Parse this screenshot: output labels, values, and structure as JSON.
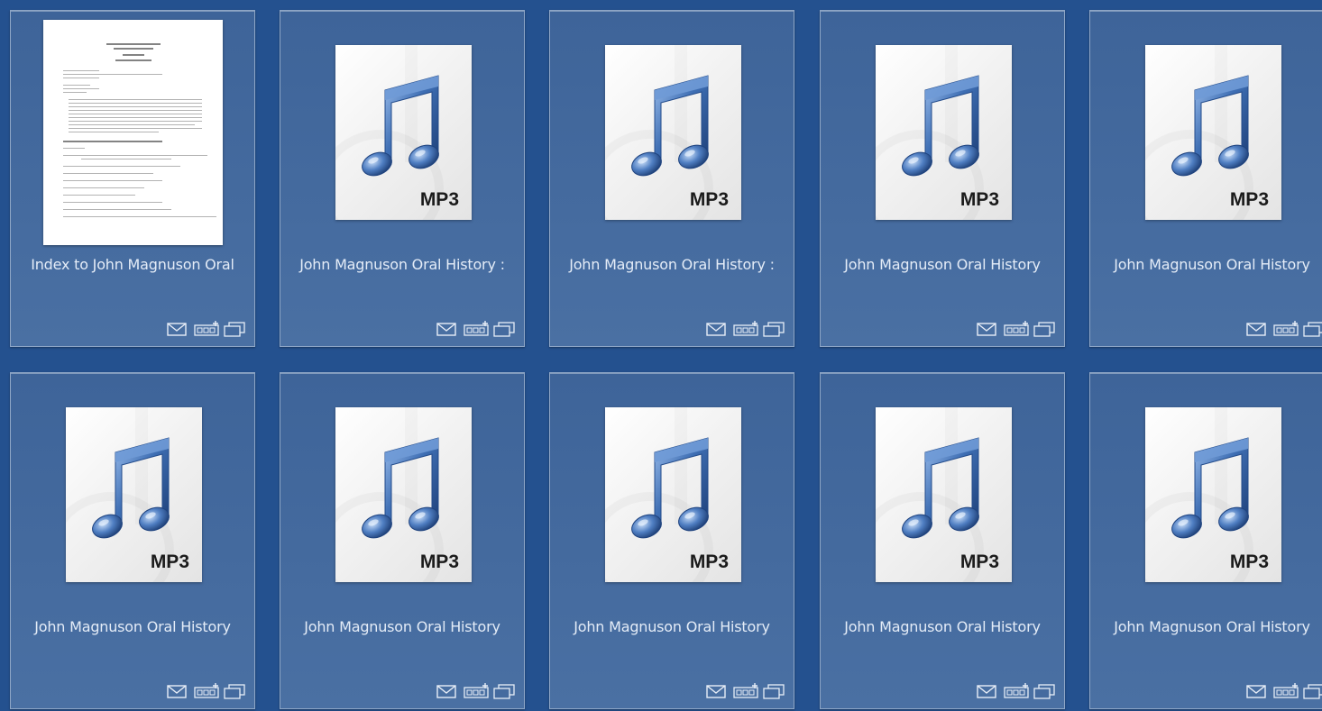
{
  "items": [
    {
      "title": "Index to John Magnuson Oral",
      "type": "document"
    },
    {
      "title": "John Magnuson Oral History :",
      "type": "audio",
      "badge": "MP3"
    },
    {
      "title": "John Magnuson Oral History :",
      "type": "audio",
      "badge": "MP3"
    },
    {
      "title": "John Magnuson Oral History",
      "type": "audio",
      "badge": "MP3"
    },
    {
      "title": "John Magnuson Oral History",
      "type": "audio",
      "badge": "MP3"
    },
    {
      "title": "John Magnuson Oral History",
      "type": "audio",
      "badge": "MP3"
    },
    {
      "title": "John Magnuson Oral History",
      "type": "audio",
      "badge": "MP3"
    },
    {
      "title": "John Magnuson Oral History",
      "type": "audio",
      "badge": "MP3"
    },
    {
      "title": "John Magnuson Oral History",
      "type": "audio",
      "badge": "MP3"
    },
    {
      "title": "John Magnuson Oral History",
      "type": "audio",
      "badge": "MP3"
    }
  ],
  "action_icons": [
    "email-icon",
    "add-to-bookbag-icon",
    "view-item-icon"
  ],
  "colors": {
    "background": "#24518f",
    "card": "#456b9f",
    "card_border": "#8ea6c6",
    "title_text": "#e4ecf7",
    "note_blue": "#3f6fb4"
  }
}
